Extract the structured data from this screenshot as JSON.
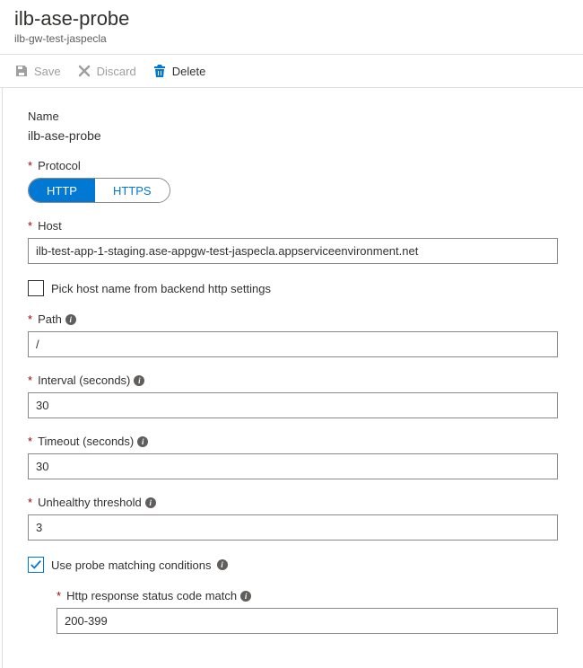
{
  "header": {
    "title": "ilb-ase-probe",
    "subtitle": "ilb-gw-test-jaspecla"
  },
  "toolbar": {
    "save_label": "Save",
    "discard_label": "Discard",
    "delete_label": "Delete"
  },
  "fields": {
    "name": {
      "label": "Name",
      "value": "ilb-ase-probe"
    },
    "protocol": {
      "label": "Protocol",
      "options": [
        "HTTP",
        "HTTPS"
      ],
      "selected": "HTTP"
    },
    "host": {
      "label": "Host",
      "value": "ilb-test-app-1-staging.ase-appgw-test-jaspecla.appserviceenvironment.net"
    },
    "pick_host": {
      "label": "Pick host name from backend http settings",
      "checked": false
    },
    "path": {
      "label": "Path",
      "value": "/"
    },
    "interval": {
      "label": "Interval (seconds)",
      "value": "30"
    },
    "timeout": {
      "label": "Timeout (seconds)",
      "value": "30"
    },
    "unhealthy": {
      "label": "Unhealthy threshold",
      "value": "3"
    },
    "use_matching": {
      "label": "Use probe matching conditions",
      "checked": true
    },
    "status_code_match": {
      "label": "Http response status code match",
      "value": "200-399"
    }
  }
}
